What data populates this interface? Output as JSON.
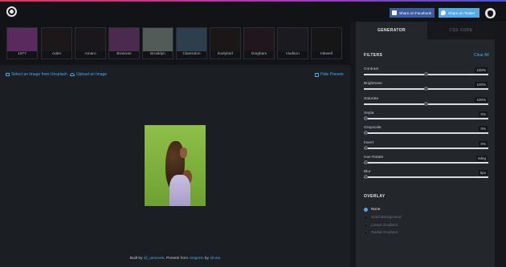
{
  "header": {
    "share_facebook": "Share on Facebook",
    "share_twitter": "Share on Twitter"
  },
  "presets": [
    {
      "label": "1977",
      "color": "#5a2a5e"
    },
    {
      "label": "Aden",
      "color": "#1c1719"
    },
    {
      "label": "Amaro",
      "color": "#19171a"
    },
    {
      "label": "Brannan",
      "color": "#4a2a4d"
    },
    {
      "label": "Brooklyn",
      "color": "#535b59"
    },
    {
      "label": "Clarendon",
      "color": "#2e3e4d"
    },
    {
      "label": "Earlybird",
      "color": "#1a1716"
    },
    {
      "label": "Gingham",
      "color": "#21161c"
    },
    {
      "label": "Hudson",
      "color": "#1a1a20"
    },
    {
      "label": "Inkwell",
      "color": "#161616"
    }
  ],
  "toolbar": {
    "select_unsplash": "Select an Image from Unsplash",
    "upload_image": "Upload an Image",
    "hide_presets": "Hide Presets"
  },
  "footer": {
    "built_by": "Built by",
    "author": "@_iamzeek",
    "presets_from": ". Presets from",
    "cssgram": "cssgram",
    "by": "by",
    "una": "@una"
  },
  "sidebar": {
    "tab_generator": "GENERATOR",
    "tab_css_code": "CSS CODE",
    "filters_title": "FILTERS",
    "clear_all": "Clear All",
    "filters": [
      {
        "name": "Contrast",
        "value": "100%",
        "level": 0.5
      },
      {
        "name": "Brightness",
        "value": "100%",
        "level": 0.5
      },
      {
        "name": "Saturate",
        "value": "100%",
        "level": 0.5
      },
      {
        "name": "Sepia",
        "value": "0%",
        "level": 0
      },
      {
        "name": "Grayscale",
        "value": "0%",
        "level": 0
      },
      {
        "name": "Invert",
        "value": "0%",
        "level": 0
      },
      {
        "name": "Hue Rotate",
        "value": "0deg",
        "level": 0
      },
      {
        "name": "Blur",
        "value": "0px",
        "level": 0
      }
    ],
    "overlay_title": "OVERLAY",
    "overlay_options": [
      {
        "label": "None",
        "selected": true
      },
      {
        "label": "Solid Background",
        "selected": false
      },
      {
        "label": "Linear Gradient",
        "selected": false
      },
      {
        "label": "Radial Gradient",
        "selected": false
      }
    ]
  },
  "colors": {
    "accent": "#4aa8e6",
    "facebook": "#3b5aa0",
    "twitter": "#55a8e6"
  }
}
